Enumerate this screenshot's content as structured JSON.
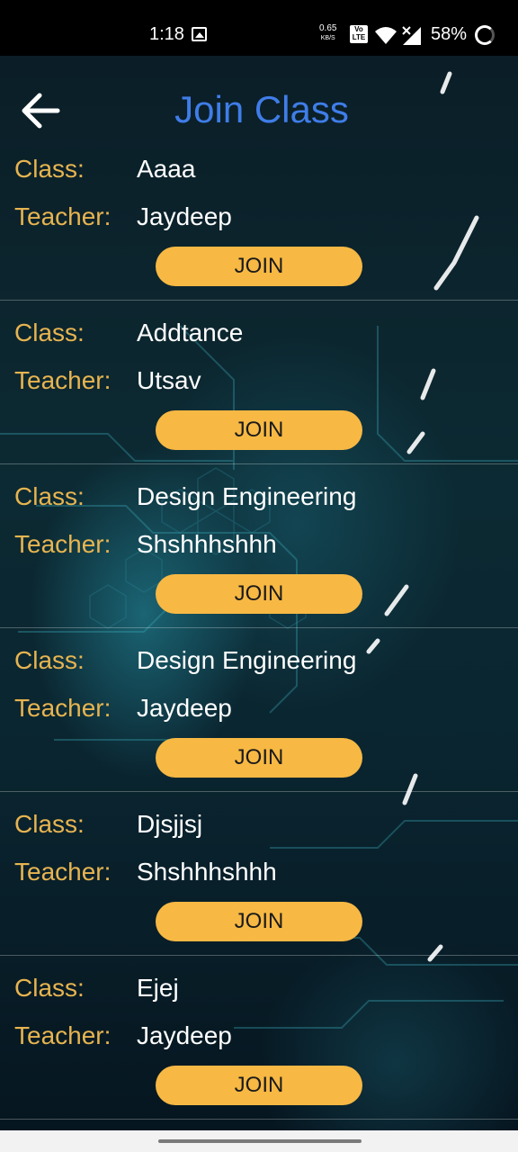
{
  "status_bar": {
    "time": "1:18",
    "net_speed_value": "0.65",
    "net_speed_unit": "KB/S",
    "volte_label": "Vo LTE",
    "battery": "58%"
  },
  "header": {
    "title": "Join Class",
    "back_icon": "arrow-left-icon"
  },
  "labels": {
    "class": "Class:",
    "teacher": "Teacher:",
    "join": "JOIN"
  },
  "classes": [
    {
      "class_name": "Aaaa",
      "teacher": "Jaydeep"
    },
    {
      "class_name": "Addtance",
      "teacher": "Utsav"
    },
    {
      "class_name": "Design Engineering",
      "teacher": "Shshhhshhh"
    },
    {
      "class_name": "Design Engineering",
      "teacher": "Jaydeep"
    },
    {
      "class_name": "Djsjjsj",
      "teacher": "Shshhhshhh"
    },
    {
      "class_name": "Ejej",
      "teacher": "Jaydeep"
    }
  ],
  "colors": {
    "title": "#3f7de8",
    "label": "#e7b450",
    "button": "#f7b844"
  }
}
